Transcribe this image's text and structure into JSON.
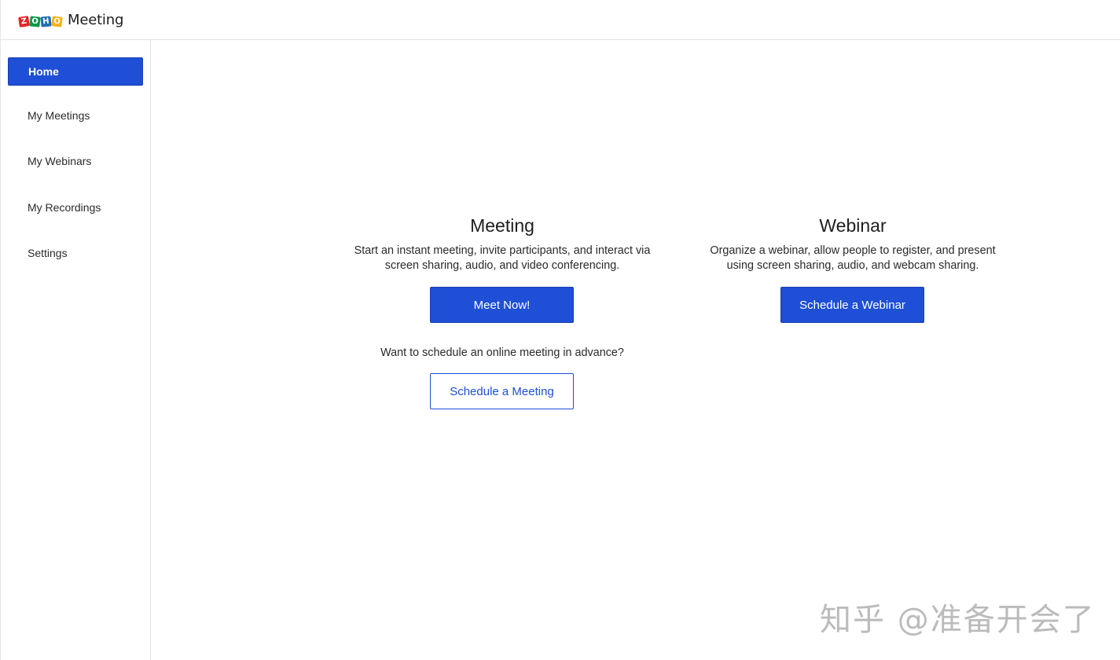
{
  "brand": {
    "logo_letters": [
      "Z",
      "O",
      "H",
      "O"
    ],
    "product_name": "Meeting"
  },
  "sidebar": {
    "items": [
      {
        "label": "Home",
        "active": true
      },
      {
        "label": "My Meetings",
        "active": false
      },
      {
        "label": "My Webinars",
        "active": false
      },
      {
        "label": "My Recordings",
        "active": false
      },
      {
        "label": "Settings",
        "active": false
      }
    ]
  },
  "meeting": {
    "title": "Meeting",
    "description_line1": "Start an instant meeting, invite participants, and interact via",
    "description_line2": "screen sharing, audio, and video conferencing.",
    "button_label": "Meet Now!",
    "advance_prompt": "Want to schedule an online meeting in advance?",
    "schedule_button_label": "Schedule a Meeting"
  },
  "webinar": {
    "title": "Webinar",
    "description_line1": "Organize a webinar, allow people to register, and present",
    "description_line2": "using screen sharing, audio, and webcam sharing.",
    "button_label": "Schedule a Webinar"
  },
  "watermark": "知乎 @准备开会了",
  "colors": {
    "accent": "#1e4fd6",
    "border": "#e2e2e2",
    "text": "#222222"
  }
}
